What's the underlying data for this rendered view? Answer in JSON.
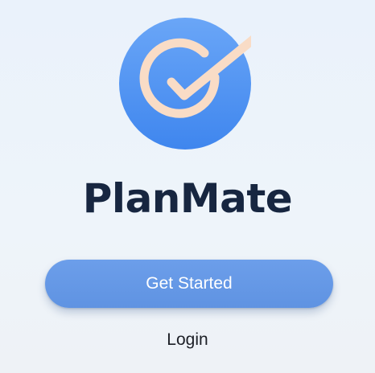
{
  "app": {
    "name": "PlanMate"
  },
  "logo": {
    "icon": "checkmark-circle-icon",
    "colors": {
      "circle_top": "#6aa6f7",
      "circle_bottom": "#3f86ee",
      "ring_and_check": "#f9dcc6"
    }
  },
  "actions": {
    "get_started_label": "Get Started",
    "login_label": "Login"
  },
  "theme": {
    "background": "#eaf2fb",
    "title_color": "#172640",
    "primary_button_color": "#6498e6",
    "primary_button_text": "#ffffff",
    "link_text": "#1c1f26"
  }
}
